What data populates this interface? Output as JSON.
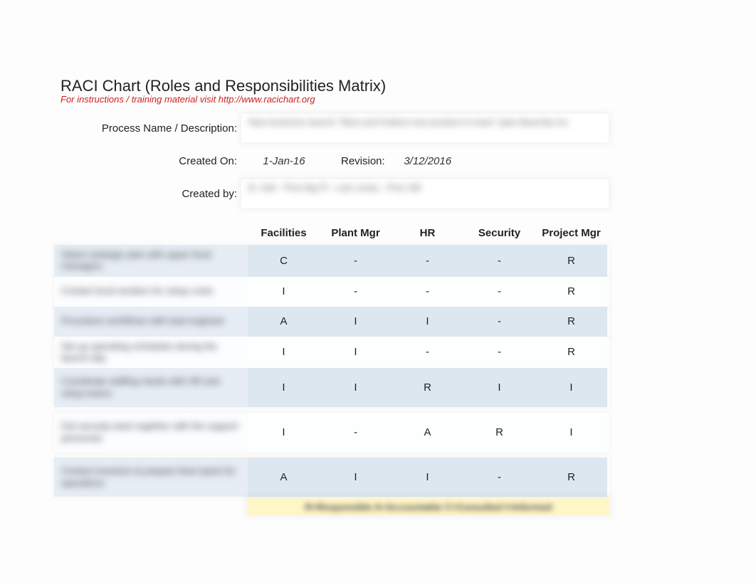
{
  "title": "RACI Chart (Roles and Responsibilities Matrix)",
  "subtitle": "For instructions / training material visit http://www.racichart.org",
  "meta": {
    "process_label": "Process Name / Description:",
    "process_value_blur": "New business launch   \"Best and hottest new product in town\"  plan   bluechip  inc",
    "created_on_label": "Created On:",
    "created_on_value": "1-Jan-16",
    "revision_label": "Revision:",
    "revision_value": "3/12/2016",
    "created_by_label": "Created by:",
    "created_by_value_blur": "B.  Hall  -  Pres  Bg  Pl  -  Lain  comp  - Pres  SB"
  },
  "roles": [
    "Facilities",
    "Plant Mgr",
    "HR",
    "Security",
    "Project Mgr"
  ],
  "tasks": [
    {
      "blur": "Select  strategic plan with upper level managers",
      "cells": [
        "C",
        "-",
        "-",
        "-",
        "R"
      ],
      "alt": true,
      "tall": false
    },
    {
      "blur": "Contact local vendors for setup costs",
      "cells": [
        "I",
        "-",
        "-",
        "-",
        "R"
      ],
      "alt": false,
      "tall": false
    },
    {
      "blur": "Procedure workflows with lead engineer",
      "cells": [
        "A",
        "I",
        "I",
        "-",
        "R"
      ],
      "alt": true,
      "tall": false
    },
    {
      "blur": "Set up operating schedules during the launch day",
      "cells": [
        "I",
        "I",
        "-",
        "-",
        "R"
      ],
      "alt": false,
      "tall": false
    },
    {
      "blur": "Coordinate staffing needs with HR and setup teams",
      "cells": [
        "I",
        "I",
        "R",
        "I",
        "I"
      ],
      "alt": true,
      "tall": true
    },
    {
      "blur": "Get security team together with the   support personnel",
      "cells": [
        "I",
        "-",
        "A",
        "R",
        "I"
      ],
      "alt": false,
      "tall": true
    },
    {
      "blur": "Contact investors & prepare final report for operations",
      "cells": [
        "A",
        "I",
        "I",
        "-",
        "R"
      ],
      "alt": true,
      "tall": true
    }
  ],
  "legend_blur": "R=Responsible  A=Accountable  C=Consulted  I=Informed",
  "chart_data": {
    "type": "table",
    "title": "RACI Chart (Roles and Responsibilities Matrix)",
    "columns": [
      "Facilities",
      "Plant Mgr",
      "HR",
      "Security",
      "Project Mgr"
    ],
    "rows": [
      [
        "C",
        "-",
        "-",
        "-",
        "R"
      ],
      [
        "I",
        "-",
        "-",
        "-",
        "R"
      ],
      [
        "A",
        "I",
        "I",
        "-",
        "R"
      ],
      [
        "I",
        "I",
        "-",
        "-",
        "R"
      ],
      [
        "I",
        "I",
        "R",
        "I",
        "I"
      ],
      [
        "I",
        "-",
        "A",
        "R",
        "I"
      ],
      [
        "A",
        "I",
        "I",
        "-",
        "R"
      ]
    ]
  }
}
